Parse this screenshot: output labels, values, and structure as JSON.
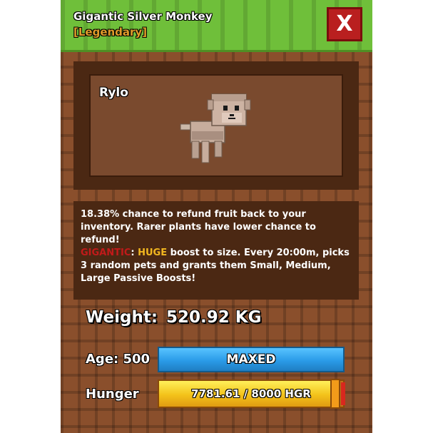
{
  "header": {
    "title": "Gigantic Silver Monkey",
    "rarity": "[Legendary]",
    "close_label": "X",
    "close_icon": "close-icon"
  },
  "preview": {
    "pet_name": "Rylo",
    "pet_icon": "silver-monkey-pet-model"
  },
  "description": {
    "line1": "18.38% chance to refund fruit back to your inventory. Rarer plants have lower chance to refund!",
    "gigantic_label": "GIGANTIC",
    "colon1": ": ",
    "huge_label": "HUGE",
    "line2": " boost to size. Every 20:00m, picks 3 random pets and grants them Small, Medium, Large Passive Boosts!"
  },
  "stats": {
    "weight_label": "Weight:",
    "weight_value": "520.92 KG",
    "age_label": "Age: 500",
    "age_bar_text": "MAXED",
    "hunger_label": "Hunger",
    "hunger_text": "7781.61 / 8000 HGR",
    "hunger_fraction": 0.9727
  },
  "colors": {
    "header_green": "#6fbf3a",
    "panel_brown": "#8a4f2c",
    "close_red": "#b91f1f",
    "rarity_orange": "#e09b2a",
    "gigantic_red": "#c21a1a",
    "huge_yellow": "#f2b720",
    "age_blue": "#2a9be8",
    "hunger_yellow": "#f3c21a"
  }
}
